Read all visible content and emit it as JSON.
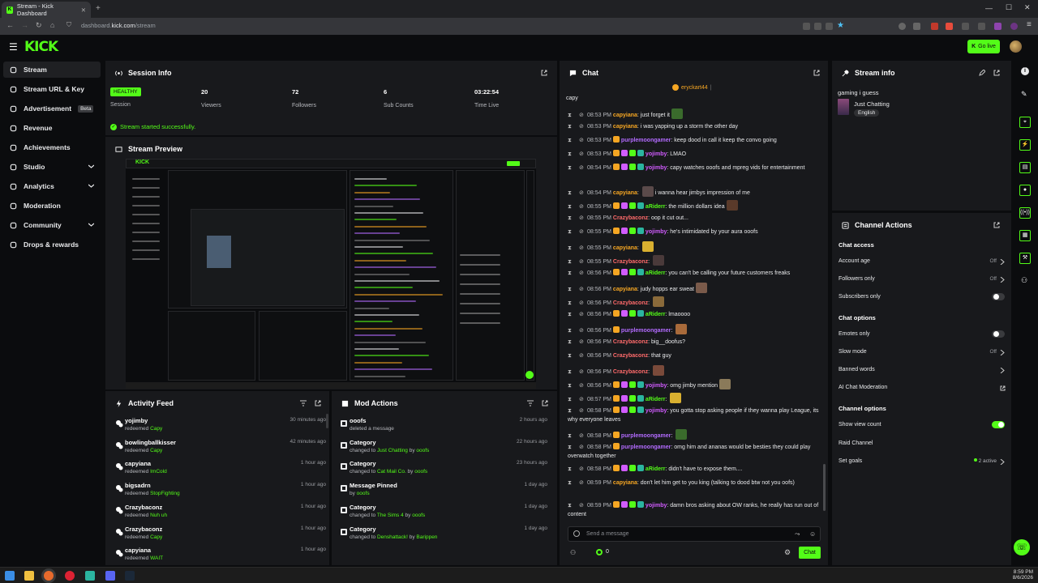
{
  "browser": {
    "tab_title": "Stream - Kick Dashboard",
    "url_prefix": "dashboard.",
    "url_domain": "kick.com",
    "url_path": "/stream"
  },
  "header": {
    "logo": "KICK",
    "go_live_label": "Go live"
  },
  "sidebar": {
    "items": [
      {
        "label": "Stream",
        "icon": "broadcast-icon"
      },
      {
        "label": "Stream URL & Key",
        "icon": "link-icon"
      },
      {
        "label": "Advertisement",
        "icon": "advertisement-icon",
        "badge": "Beta"
      },
      {
        "label": "Revenue",
        "icon": "revenue-icon"
      },
      {
        "label": "Achievements",
        "icon": "trophy-icon"
      },
      {
        "label": "Studio",
        "icon": "studio-icon"
      },
      {
        "label": "Analytics",
        "icon": "analytics-icon"
      },
      {
        "label": "Moderation",
        "icon": "moderation-icon"
      },
      {
        "label": "Community",
        "icon": "community-icon"
      },
      {
        "label": "Drops & rewards",
        "icon": "gift-icon"
      }
    ]
  },
  "session": {
    "title": "Session Info",
    "status": "HEALTHY",
    "status_label": "Session",
    "stats": [
      {
        "value": "20",
        "label": "Viewers"
      },
      {
        "value": "72",
        "label": "Followers"
      },
      {
        "value": "6",
        "label": "Sub Counts"
      },
      {
        "value": "03:22:54",
        "label": "Time Live"
      }
    ],
    "notice": "Stream started successfully."
  },
  "preview": {
    "title": "Stream Preview"
  },
  "activity": {
    "title": "Activity Feed",
    "items": [
      {
        "name": "yojimby",
        "verb": "redeemed",
        "reward": "Capy",
        "time": "30 minutes ago"
      },
      {
        "name": "bowlingballkisser",
        "verb": "redeemed",
        "reward": "Capy",
        "time": "42 minutes ago"
      },
      {
        "name": "capyiana",
        "verb": "redeemed",
        "reward": "ImCold",
        "time": "1 hour ago"
      },
      {
        "name": "bigsadrn",
        "verb": "redeemed",
        "reward": "StopFighting",
        "time": "1 hour ago"
      },
      {
        "name": "Crazybaconz",
        "verb": "redeemed",
        "reward": "Nuh uh",
        "time": "1 hour ago"
      },
      {
        "name": "Crazybaconz",
        "verb": "redeemed",
        "reward": "Capy",
        "time": "1 hour ago"
      },
      {
        "name": "capyiana",
        "verb": "redeemed",
        "reward": "WAIT",
        "time": "1 hour ago"
      }
    ]
  },
  "modactions": {
    "title": "Mod Actions",
    "items": [
      {
        "name": "ooofs",
        "line2a": "deleted a message",
        "line2b": "",
        "line2c": "",
        "line2d": "",
        "time": "2 hours ago",
        "icon": "trash-icon"
      },
      {
        "name": "Category",
        "line2a": "changed to ",
        "line2b": "Just Chatting",
        "line2c": " by ",
        "line2d": "ooofs",
        "time": "22 hours ago",
        "icon": "category-icon"
      },
      {
        "name": "Category",
        "line2a": "changed to ",
        "line2b": "Cat Mail Co.",
        "line2c": " by ",
        "line2d": "ooofs",
        "time": "23 hours ago",
        "icon": "category-icon"
      },
      {
        "name": "Message Pinned",
        "line2a": "by ",
        "line2b": "ooofs",
        "line2c": "",
        "line2d": "",
        "time": "1 day ago",
        "icon": "pin-icon"
      },
      {
        "name": "Category",
        "line2a": "changed to ",
        "line2b": "The Sims 4",
        "line2c": " by ",
        "line2d": "ooofs",
        "time": "1 day ago",
        "icon": "category-icon"
      },
      {
        "name": "Category",
        "line2a": "changed to ",
        "line2b": "Denshattack!",
        "line2c": " by ",
        "line2d": "Barippen",
        "time": "1 day ago",
        "icon": "category-icon"
      }
    ]
  },
  "chat": {
    "title": "Chat",
    "pinned_user": "eryckart44",
    "top_text": "capy",
    "input_placeholder": "Send a message",
    "chat_button": "Chat",
    "viewer_count": "0",
    "messages": [
      {
        "time": "08:53 PM",
        "user": "capyiana",
        "color": "#f5a623",
        "text": "just forget it",
        "badges": 0,
        "emote": true
      },
      {
        "time": "08:53 PM",
        "user": "capyiana",
        "color": "#f5a623",
        "text": "i was yapping up a storm the other day",
        "badges": 0
      },
      {
        "time": "08:53 PM",
        "user": "purplemoongamer",
        "color": "#b36bff",
        "text": "keep dood in call it keep the convo going",
        "badges": 1
      },
      {
        "time": "08:53 PM",
        "user": "yojimby",
        "color": "#d15cff",
        "text": "LMAO",
        "badges": 4
      },
      {
        "time": "08:54 PM",
        "user": "yojimby",
        "color": "#d15cff",
        "text": "capy watches ooofs and mpreg vids for entertainment",
        "badges": 4
      },
      {
        "time": "08:54 PM",
        "user": "capyiana",
        "color": "#f5a623",
        "text": "i wanna hear jimbys impression of me",
        "badges": 0,
        "pre_emote": true
      },
      {
        "time": "08:55 PM",
        "user": "aRiderr",
        "color": "#53fc18",
        "text": "the million dollars idea",
        "badges": 4,
        "emote": true
      },
      {
        "time": "08:55 PM",
        "user": "Crazybaconz",
        "color": "#ff6b6b",
        "text": "oop it cut out...",
        "badges": 0
      },
      {
        "time": "08:55 PM",
        "user": "yojimby",
        "color": "#d15cff",
        "text": "he's intimidated by your aura ooofs",
        "badges": 4
      },
      {
        "time": "08:55 PM",
        "user": "capyiana",
        "color": "#f5a623",
        "text": "",
        "badges": 0,
        "emote": true
      },
      {
        "time": "08:55 PM",
        "user": "Crazybaconz",
        "color": "#ff6b6b",
        "text": "",
        "badges": 0,
        "emote": true
      },
      {
        "time": "08:56 PM",
        "user": "aRiderr",
        "color": "#53fc18",
        "text": "you can't be calling your future customers freaks",
        "badges": 4
      },
      {
        "time": "08:56 PM",
        "user": "capyiana",
        "color": "#f5a623",
        "text": "judy hopps ear sweat",
        "badges": 0,
        "emote": true
      },
      {
        "time": "08:56 PM",
        "user": "Crazybaconz",
        "color": "#ff6b6b",
        "text": "",
        "badges": 0,
        "emote": true
      },
      {
        "time": "08:56 PM",
        "user": "aRiderr",
        "color": "#53fc18",
        "text": "lmaoooo",
        "badges": 4
      },
      {
        "time": "08:56 PM",
        "user": "purplemoongamer",
        "color": "#b36bff",
        "text": "",
        "badges": 1,
        "emote": true
      },
      {
        "time": "08:56 PM",
        "user": "Crazybaconz",
        "color": "#ff6b6b",
        "text": "big__doofus?",
        "badges": 0
      },
      {
        "time": "08:56 PM",
        "user": "Crazybaconz",
        "color": "#ff6b6b",
        "text": "that guy",
        "badges": 0
      },
      {
        "time": "08:56 PM",
        "user": "Crazybaconz",
        "color": "#ff6b6b",
        "text": "",
        "badges": 0,
        "emote": true
      },
      {
        "time": "08:56 PM",
        "user": "yojimby",
        "color": "#d15cff",
        "text": "omg jimby mention",
        "badges": 4,
        "emote": true
      },
      {
        "time": "08:57 PM",
        "user": "aRiderr",
        "color": "#53fc18",
        "text": "",
        "badges": 4,
        "emote": true
      },
      {
        "time": "08:58 PM",
        "user": "yojimby",
        "color": "#d15cff",
        "text": "you gotta stop asking people if they wanna play League, its why everyone leaves",
        "badges": 4
      },
      {
        "time": "08:58 PM",
        "user": "purplemoongamer",
        "color": "#b36bff",
        "text": "",
        "badges": 1,
        "emote": true
      },
      {
        "time": "08:58 PM",
        "user": "purplemoongamer",
        "color": "#b36bff",
        "text": "omg him and ananas would be besties they could play overwatch together",
        "badges": 1
      },
      {
        "time": "08:58 PM",
        "user": "aRiderr",
        "color": "#53fc18",
        "text": "didn't have to expose them....",
        "badges": 4
      },
      {
        "time": "08:59 PM",
        "user": "capyiana",
        "color": "#f5a623",
        "text": "don't let him get to you king (talking to dood btw not you oofs)",
        "badges": 0
      },
      {
        "time": "08:59 PM",
        "user": "yojimby",
        "color": "#d15cff",
        "text": "damn bros asking about OW ranks, he really has run out of content",
        "badges": 4
      }
    ]
  },
  "streaminfo": {
    "title": "Stream info",
    "stream_title": "gaming i guess",
    "category": "Just Chatting",
    "language": "English"
  },
  "channelactions": {
    "title": "Channel Actions",
    "chat_access": "Chat access",
    "account_age": "Account age",
    "account_age_val": "Off",
    "followers_only": "Followers only",
    "followers_only_val": "Off",
    "subscribers_only": "Subscribers only",
    "chat_options": "Chat options",
    "emotes_only": "Emotes only",
    "slow_mode": "Slow mode",
    "slow_mode_val": "Off",
    "banned_words": "Banned words",
    "ai_mod": "AI Chat Moderation",
    "channel_options": "Channel options",
    "show_view_count": "Show view count",
    "raid_channel": "Raid Channel",
    "set_goals": "Set goals",
    "set_goals_val": "2 active"
  },
  "clock": {
    "time": "8:59 PM",
    "date": "8/6/2026"
  },
  "colors": {
    "accent": "#53fc18",
    "panel": "#18191c",
    "bg": "#0b0c0e"
  }
}
